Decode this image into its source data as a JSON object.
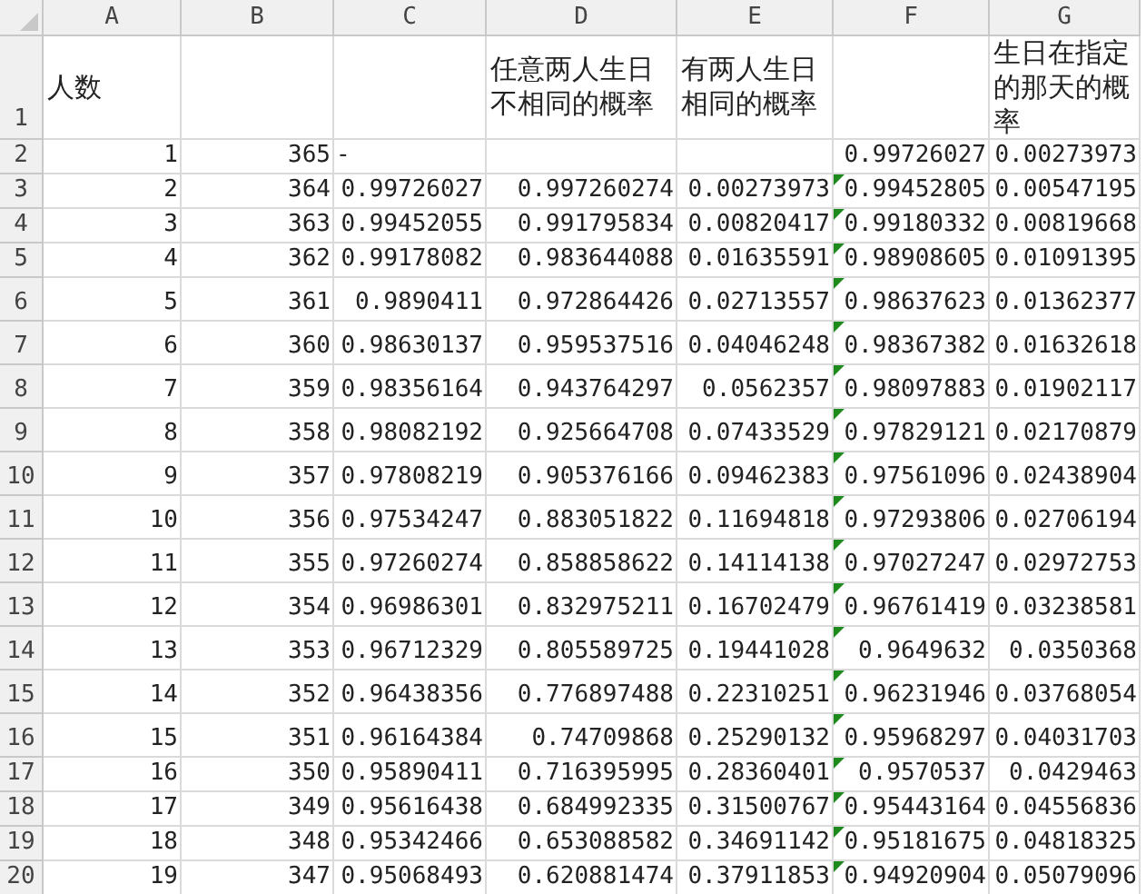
{
  "columns": [
    "A",
    "B",
    "C",
    "D",
    "E",
    "F",
    "G"
  ],
  "header_row": {
    "number": "1",
    "cells": [
      "人数",
      null,
      null,
      "任意两人生日不相同的概率",
      "有两人生日相同的概率",
      null,
      "生日在指定的那天的概率"
    ]
  },
  "rows": [
    {
      "number": "2",
      "f_marker": false,
      "cells": [
        "1",
        "365",
        {
          "kind": "text",
          "text": "-"
        },
        null,
        null,
        "0.99726027",
        "0.00273973"
      ]
    },
    {
      "number": "3",
      "f_marker": true,
      "cells": [
        "2",
        "364",
        "0.99726027",
        "0.997260274",
        "0.00273973",
        "0.99452805",
        "0.00547195"
      ]
    },
    {
      "number": "4",
      "f_marker": true,
      "cells": [
        "3",
        "363",
        "0.99452055",
        "0.991795834",
        "0.00820417",
        "0.99180332",
        "0.00819668"
      ]
    },
    {
      "number": "5",
      "f_marker": true,
      "cells": [
        "4",
        "362",
        "0.99178082",
        "0.983644088",
        "0.01635591",
        "0.98908605",
        "0.01091395"
      ]
    },
    {
      "number": "6",
      "f_marker": true,
      "cells": [
        "5",
        "361",
        "0.9890411",
        "0.972864426",
        "0.02713557",
        "0.98637623",
        "0.01362377"
      ]
    },
    {
      "number": "7",
      "f_marker": true,
      "cells": [
        "6",
        "360",
        "0.98630137",
        "0.959537516",
        "0.04046248",
        "0.98367382",
        "0.01632618"
      ]
    },
    {
      "number": "8",
      "f_marker": true,
      "cells": [
        "7",
        "359",
        "0.98356164",
        "0.943764297",
        "0.0562357",
        "0.98097883",
        "0.01902117"
      ]
    },
    {
      "number": "9",
      "f_marker": true,
      "cells": [
        "8",
        "358",
        "0.98082192",
        "0.925664708",
        "0.07433529",
        "0.97829121",
        "0.02170879"
      ]
    },
    {
      "number": "10",
      "f_marker": true,
      "cells": [
        "9",
        "357",
        "0.97808219",
        "0.905376166",
        "0.09462383",
        "0.97561096",
        "0.02438904"
      ]
    },
    {
      "number": "11",
      "f_marker": true,
      "cells": [
        "10",
        "356",
        "0.97534247",
        "0.883051822",
        "0.11694818",
        "0.97293806",
        "0.02706194"
      ]
    },
    {
      "number": "12",
      "f_marker": true,
      "cells": [
        "11",
        "355",
        "0.97260274",
        "0.858858622",
        "0.14114138",
        "0.97027247",
        "0.02972753"
      ]
    },
    {
      "number": "13",
      "f_marker": true,
      "cells": [
        "12",
        "354",
        "0.96986301",
        "0.832975211",
        "0.16702479",
        "0.96761419",
        "0.03238581"
      ]
    },
    {
      "number": "14",
      "f_marker": true,
      "cells": [
        "13",
        "353",
        "0.96712329",
        "0.805589725",
        "0.19441028",
        "0.9649632",
        "0.0350368"
      ]
    },
    {
      "number": "15",
      "f_marker": true,
      "cells": [
        "14",
        "352",
        "0.96438356",
        "0.776897488",
        "0.22310251",
        "0.96231946",
        "0.03768054"
      ]
    },
    {
      "number": "16",
      "f_marker": true,
      "cells": [
        "15",
        "351",
        "0.96164384",
        "0.74709868",
        "0.25290132",
        "0.95968297",
        "0.04031703"
      ]
    },
    {
      "number": "17",
      "f_marker": true,
      "cells": [
        "16",
        "350",
        "0.95890411",
        "0.716395995",
        "0.28360401",
        "0.9570537",
        "0.0429463"
      ]
    },
    {
      "number": "18",
      "f_marker": true,
      "cells": [
        "17",
        "349",
        "0.95616438",
        "0.684992335",
        "0.31500767",
        "0.95443164",
        "0.04556836"
      ]
    },
    {
      "number": "19",
      "f_marker": true,
      "cells": [
        "18",
        "348",
        "0.95342466",
        "0.653088582",
        "0.34691142",
        "0.95181675",
        "0.04818325"
      ]
    },
    {
      "number": "20",
      "f_marker": true,
      "cells": [
        "19",
        "347",
        "0.95068493",
        "0.620881474",
        "0.37911853",
        "0.94920904",
        "0.05079096"
      ]
    }
  ]
}
